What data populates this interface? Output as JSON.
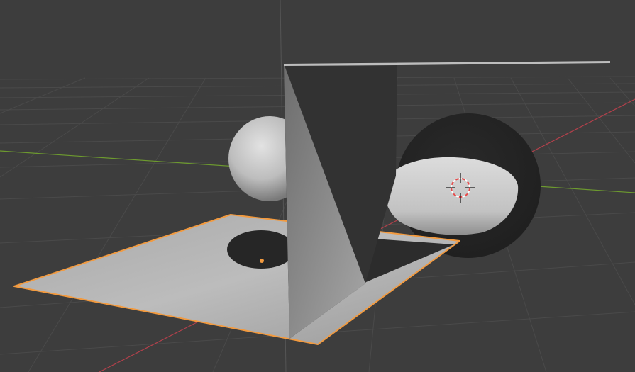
{
  "app": "3D Viewport",
  "colors": {
    "background": "#3d3d3d",
    "grid_line": "#4a4a4a",
    "x_axis": "#b2404b",
    "y_axis": "#6d9a2f",
    "selection_outline": "#f29a3f",
    "origin_dot": "#f29a3f",
    "cursor_red": "#e84a4a",
    "cursor_white": "#ffffff"
  },
  "scene": {
    "objects": [
      {
        "name": "plane",
        "selected": true,
        "icon": "plane-mesh"
      },
      {
        "name": "sphere-back",
        "selected": false,
        "icon": "uv-sphere"
      },
      {
        "name": "sphere-front",
        "selected": false,
        "icon": "uv-sphere"
      },
      {
        "name": "shadow-casting-wall",
        "selected": false,
        "icon": "plane-mesh"
      }
    ],
    "cursor_icon": "3d-cursor-icon"
  }
}
